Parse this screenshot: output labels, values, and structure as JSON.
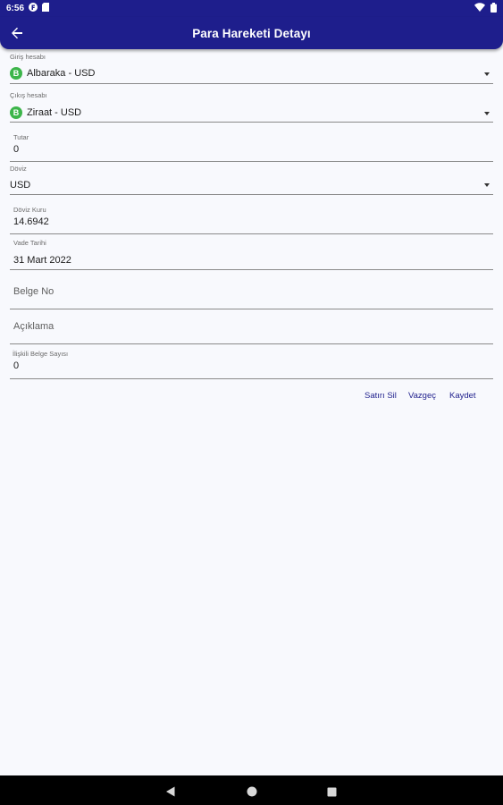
{
  "status_bar": {
    "time": "6:56",
    "icons": [
      "notification-f-icon",
      "sim-card-icon",
      "wifi-icon",
      "battery-icon"
    ]
  },
  "app_bar": {
    "title": "Para Hareketi Detayı",
    "back_icon": "arrow-left-icon"
  },
  "form": {
    "giris_hesabi": {
      "label": "Giriş hesabı",
      "badge": "B",
      "value": "Albaraka - USD"
    },
    "cikis_hesabi": {
      "label": "Çıkış hesabı",
      "badge": "B",
      "value": "Ziraat - USD"
    },
    "tutar": {
      "label": "Tutar",
      "value": "0"
    },
    "doviz": {
      "label": "Döviz",
      "value": "USD"
    },
    "doviz_kuru": {
      "label": "Döviz Kuru",
      "value": "14.6942"
    },
    "vade_tarihi": {
      "label": "Vade Tarihi",
      "value": "31 Mart 2022"
    },
    "belge_no": {
      "placeholder": "Belge No"
    },
    "aciklama": {
      "placeholder": "Açıklama"
    },
    "iliskili_belge_sayisi": {
      "label": "İlişkili Belge Sayısı",
      "value": "0"
    }
  },
  "actions": {
    "delete_label": "Satırı Sil",
    "cancel_label": "Vazgeç",
    "save_label": "Kaydet"
  },
  "colors": {
    "primary": "#1e1e8c",
    "badge_green": "#3cb54a",
    "background": "#f8f9fd"
  },
  "nav_bar": {
    "icons": [
      "back-triangle-icon",
      "home-circle-icon",
      "recents-square-icon"
    ]
  }
}
